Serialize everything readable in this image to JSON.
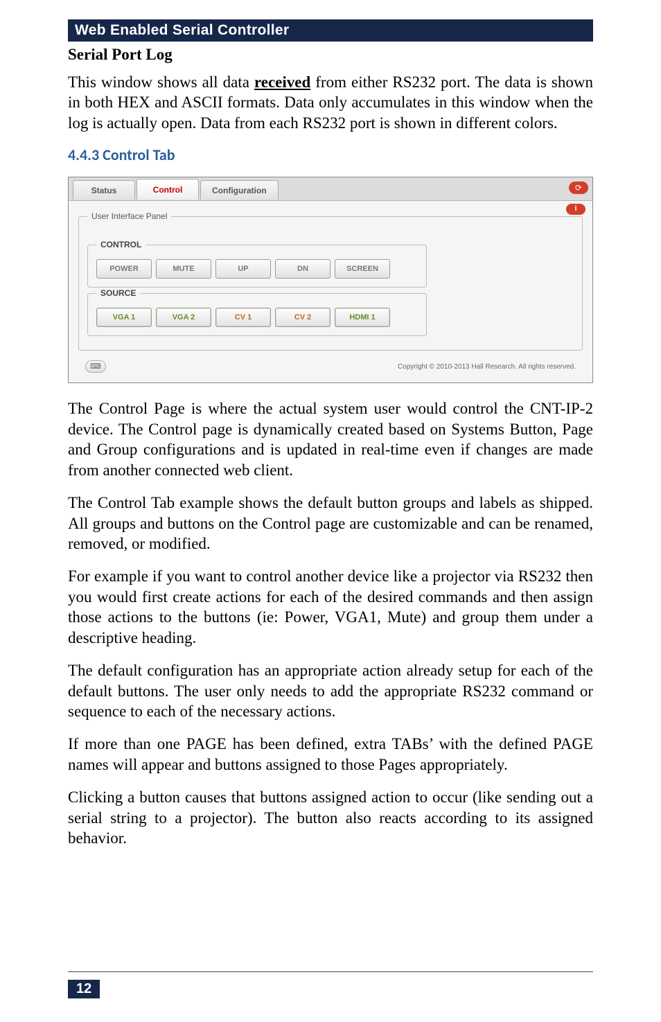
{
  "header": {
    "title": "Web Enabled Serial Controller"
  },
  "section1": {
    "heading": "Serial Port Log",
    "para_pre": "This window shows all data ",
    "para_u": "received",
    "para_post": " from either RS232 port. The data is shown in both HEX and ASCII formats. Data only accumulates in this window when the log is actually open. Data from each RS232 port is shown in different colors."
  },
  "section2": {
    "heading": "4.4.3 Control Tab"
  },
  "ui": {
    "tabs": {
      "status": "Status",
      "control": "Control",
      "config": "Configuration"
    },
    "refresh_glyph": "⟳",
    "info_glyph": "i",
    "panel_legend": "User Interface Panel",
    "group_control": {
      "legend": "CONTROL",
      "buttons": [
        "POWER",
        "MUTE",
        "UP",
        "DN",
        "SCREEN"
      ]
    },
    "group_source": {
      "legend": "SOURCE",
      "buttons": [
        "VGA 1",
        "VGA 2",
        "CV 1",
        "CV 2",
        "HDMI 1"
      ]
    },
    "kb_glyph": "⌨",
    "copyright": "Copyright © 2010-2013 Hall Research. All rights reserved."
  },
  "paras": {
    "p1": "The Control Page is where the actual system user would control the CNT-IP-2 device. The Control page is dynamically created based on Systems Button, Page and Group configurations and is updated in real-time even if changes are made from another connected web client.",
    "p2": "The Control Tab example shows the default button groups and labels as shipped. All groups and buttons on the Control page are customizable and can be renamed, removed, or modified.",
    "p3": "For example if you want to control another device like a projector via RS232 then you would first create actions for each of the desired commands and then assign those actions to the buttons (ie: Power, VGA1, Mute) and group them under a descriptive heading.",
    "p4": "The default configuration has an appropriate action already setup for each of the default buttons. The user only needs to add the appropriate RS232 command or sequence to each of the necessary actions.",
    "p5": "If more than one PAGE has been defined, extra TABs’ with the defined PAGE names will appear and buttons assigned to those Pages appropriately.",
    "p6": "Clicking a button causes that buttons assigned action to occur (like sending out a serial string to a projector). The button also reacts according to its assigned behavior."
  },
  "page_number": "12"
}
